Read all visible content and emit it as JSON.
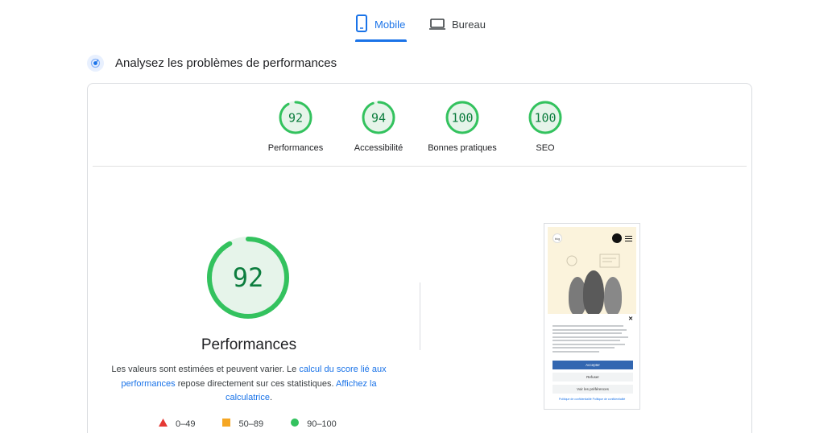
{
  "tabs": [
    {
      "label": "Mobile",
      "icon": "smartphone-icon",
      "active": true
    },
    {
      "label": "Bureau",
      "icon": "laptop-icon",
      "active": false
    }
  ],
  "section": {
    "title": "Analysez les problèmes de performances"
  },
  "scores": [
    {
      "label": "Performances",
      "value": 92
    },
    {
      "label": "Accessibilité",
      "value": 94
    },
    {
      "label": "Bonnes pratiques",
      "value": 100
    },
    {
      "label": "SEO",
      "value": 100
    }
  ],
  "performance": {
    "score": 92,
    "title": "Performances",
    "desc_part1": "Les valeurs sont estimées et peuvent varier. Le ",
    "desc_link1": "calcul du score lié aux performances",
    "desc_part2": " repose directement sur ces statistiques. ",
    "desc_link2": "Affichez la calculatrice",
    "desc_part3": "."
  },
  "legend": [
    {
      "range": "0–49",
      "shape": "triangle",
      "color": "#e53935"
    },
    {
      "range": "50–89",
      "shape": "square",
      "color": "#f5a623"
    },
    {
      "range": "90–100",
      "shape": "circle",
      "color": "#33c25e"
    }
  ],
  "phone": {
    "logo": "bkg",
    "accept": "Accepter",
    "refuse": "Refuser",
    "prefs": "Voir les préférences",
    "footer": "Politique de confidentialité   Politique de confidentialité"
  },
  "colors": {
    "good": "#0c7d3e",
    "good_ring": "#33c25e",
    "good_fill": "#e6f4ea",
    "accent": "#1a73e8"
  }
}
